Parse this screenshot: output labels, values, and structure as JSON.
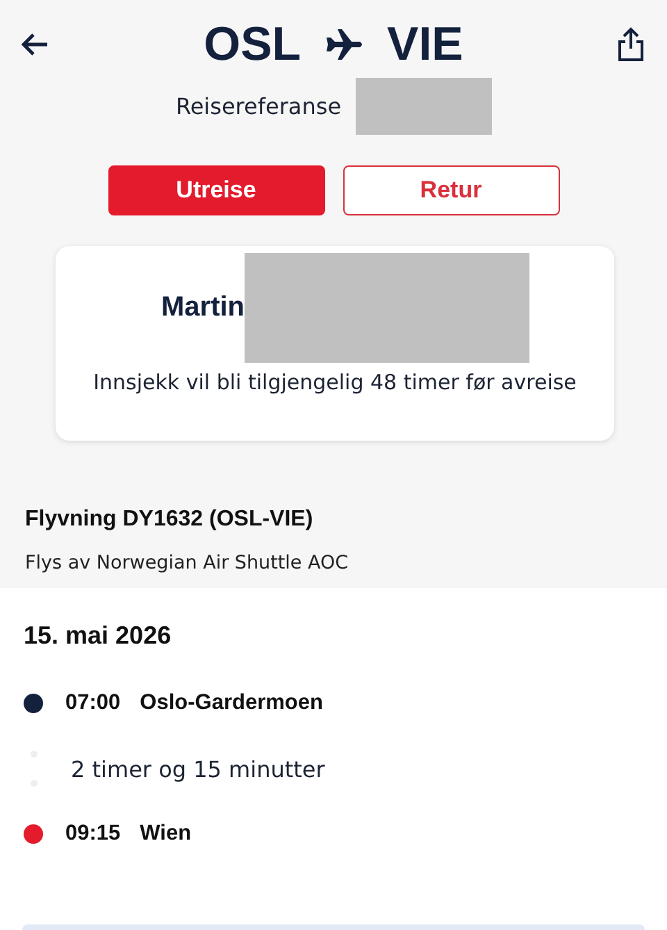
{
  "header": {
    "origin": "OSL",
    "destination": "VIE"
  },
  "booking": {
    "label": "Reisereferanse"
  },
  "tabs": [
    {
      "label": "Utreise",
      "selected": true
    },
    {
      "label": "Retur",
      "selected": false
    }
  ],
  "checkin_card": {
    "passenger": "Martin",
    "message": "Innsjekk vil bli tilgjengelig 48 timer før avreise"
  },
  "flight": {
    "title": "Flyvning DY1632 (OSL-VIE)",
    "operator": "Flys av Norwegian Air Shuttle AOC"
  },
  "itinerary": {
    "date": "15. mai 2026",
    "stops": [
      {
        "time": "07:00",
        "place": "Oslo-Gardermoen",
        "color": "#14213d"
      },
      {
        "time": "09:15",
        "place": "Wien",
        "color": "#e31b2c"
      }
    ],
    "duration": "2 timer og 15 minutter"
  }
}
